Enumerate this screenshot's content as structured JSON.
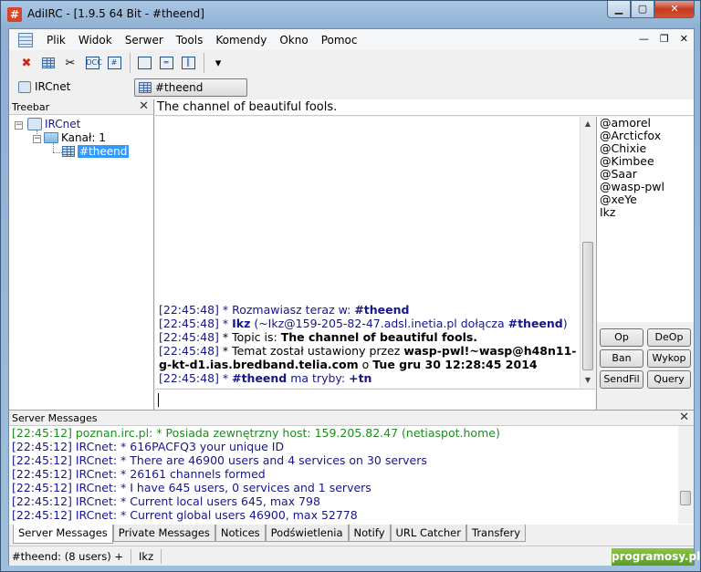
{
  "window": {
    "title": "AdiIRC - [1.9.5 64 Bit - #theend]",
    "app_icon_glyph": "#"
  },
  "menu": {
    "items": [
      "Plik",
      "Widok",
      "Serwer",
      "Tools",
      "Komendy",
      "Okno",
      "Pomoc"
    ]
  },
  "tabs": {
    "server": "IRCnet",
    "channel": "#theend"
  },
  "treebar": {
    "title": "Treebar",
    "server": "IRCnet",
    "folder": "Kanał: 1",
    "channel": "#theend"
  },
  "topic": "The channel of beautiful fools.",
  "chat": [
    {
      "ts": "[22:45:48]",
      "parts": [
        {
          "t": " * Rozmawiasz teraz w: ",
          "c": "blue"
        },
        {
          "t": "#theend",
          "c": "blue-b"
        }
      ]
    },
    {
      "ts": "[22:45:48]",
      "parts": [
        {
          "t": " * ",
          "c": "blue"
        },
        {
          "t": "Ikz",
          "c": "blue-b"
        },
        {
          "t": " (~Ikz@159-205-82-47.adsl.inetia.pl dołącza ",
          "c": "blue"
        },
        {
          "t": "#theend",
          "c": "blue-b"
        },
        {
          "t": ")",
          "c": "blue"
        }
      ]
    },
    {
      "ts": "[22:45:48]",
      "parts": [
        {
          "t": " * Topic is: ",
          "c": "black"
        },
        {
          "t": "The channel of beautiful fools.",
          "c": "black-b"
        }
      ]
    },
    {
      "ts": "[22:45:48]",
      "parts": [
        {
          "t": " * Temat został ustawiony przez ",
          "c": "black"
        },
        {
          "t": "wasp-pwl!~wasp@h48n11-g-kt-d1.ias.bredband.telia.com",
          "c": "black-b"
        },
        {
          "t": " o ",
          "c": "black"
        },
        {
          "t": "Tue gru 30 12:28:45 2014",
          "c": "black-b"
        }
      ]
    },
    {
      "ts": "[22:45:48]",
      "parts": [
        {
          "t": " * ",
          "c": "blue"
        },
        {
          "t": "#theend",
          "c": "blue-b"
        },
        {
          "t": " ma tryby: ",
          "c": "blue"
        },
        {
          "t": "+tn",
          "c": "blue-b"
        }
      ]
    }
  ],
  "nicks": [
    "@amorel",
    "@Arcticfox",
    "@Chixie",
    "@Kimbee",
    "@Saar",
    "@wasp-pwl",
    "@xeYe",
    "Ikz"
  ],
  "nick_buttons": {
    "op": "Op",
    "deop": "DeOp",
    "ban": "Ban",
    "kick": "Wykop",
    "sendfile": "SendFil",
    "query": "Query"
  },
  "server_messages": {
    "title": "Server Messages",
    "lines": [
      {
        "text": "[22:45:12] poznan.irc.pl: * Posiada zewnętrzny host: 159.205.82.47 (netiaspot.home)",
        "color": "green"
      },
      {
        "text": "[22:45:12] IRCnet: * 616PACFQ3 your unique ID",
        "color": "blue"
      },
      {
        "text": "[22:45:12] IRCnet: * There are 46900 users and 4 services on 30 servers",
        "color": "blue"
      },
      {
        "text": "[22:45:12] IRCnet: * 26161 channels formed",
        "color": "blue"
      },
      {
        "text": "[22:45:12] IRCnet: * I have 645 users, 0 services and 1 servers",
        "color": "blue"
      },
      {
        "text": "[22:45:12] IRCnet: * Current local users 645, max 798",
        "color": "blue"
      },
      {
        "text": "[22:45:12] IRCnet: * Current global users 46900, max 52778",
        "color": "blue"
      }
    ]
  },
  "bottom_tabs": [
    "Server Messages",
    "Private Messages",
    "Notices",
    "Podświetlenia",
    "Notify",
    "URL Catcher",
    "Transfery"
  ],
  "statusbar": {
    "channel": "#theend: (8 users) +",
    "nick": "Ikz",
    "brand": "programosy.pl"
  },
  "colors": {
    "blue_text": "#16168b",
    "green_text": "#1e8c1e",
    "selection": "#3399ff"
  }
}
